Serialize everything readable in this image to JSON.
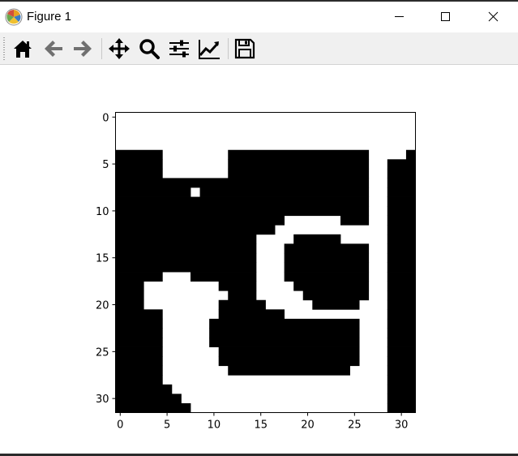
{
  "window": {
    "title": "Figure 1"
  },
  "titlebar_icons": {
    "app": "matplotlib-logo-icon",
    "minimize": "minimize-icon",
    "maximize": "maximize-icon",
    "close": "close-icon"
  },
  "toolbar": {
    "buttons": [
      {
        "name": "home",
        "icon": "home-icon"
      },
      {
        "name": "back",
        "icon": "arrow-left-icon"
      },
      {
        "name": "forward",
        "icon": "arrow-right-icon"
      },
      {
        "name": "pan",
        "icon": "move-icon"
      },
      {
        "name": "zoom",
        "icon": "magnifier-icon"
      },
      {
        "name": "configure-subplots",
        "icon": "sliders-icon"
      },
      {
        "name": "edit-axis",
        "icon": "line-chart-icon"
      },
      {
        "name": "save",
        "icon": "floppy-disk-icon"
      }
    ]
  },
  "colors": {
    "foreground": "#000000",
    "background": "#ffffff",
    "toolbar": "#f0f0f0"
  },
  "chart_data": {
    "type": "heatmap",
    "colormap": "gray (binary: black = 0, white = 1)",
    "rows": 32,
    "cols": 32,
    "xticks": [
      "0",
      "5",
      "10",
      "15",
      "20",
      "25",
      "30"
    ],
    "yticks": [
      "0",
      "5",
      "10",
      "15",
      "20",
      "25",
      "30"
    ],
    "xlim": [
      -0.5,
      31.5
    ],
    "ylim": [
      31.5,
      -0.5
    ],
    "grid": [
      "11111111111111111111111111111111",
      "11111111111111111111111111111111",
      "11111111111111111111111111111111",
      "11111111111111111111111111111111",
      "00000111111100000000000000011110",
      "00000111111100000000000000011000",
      "00000111111100000000000000011000",
      "00000000000000000000000000011000",
      "00000000100000000000000000011000",
      "00000000000000000000000000011000",
      "00000000000000000000000000011000",
      "00000000000000000011111100011000",
      "00000000000000000111111111111000",
      "00000000000000011110000011111000",
      "00000000000000011100000000011000",
      "00000000000000011100000000011000",
      "00000000000000011100000000011000",
      "00000111000000011100000000011000",
      "00011111111000011110000000011000",
      "00011111111100011111000000011000",
      "00011111111000001111100000111000",
      "00000111111000000011111111111000",
      "00000111110000000000000000111000",
      "00000111110000000000000000111000",
      "00000111110000000000000000111000",
      "00000111111000000000000000111000",
      "00000111111000000000000000111000",
      "00000111111100000000000001111000",
      "00000111111111111111111111111000",
      "00000011111111111111111111111000",
      "00000001111111111111111111111000",
      "00000000111111111111111111111000"
    ]
  }
}
